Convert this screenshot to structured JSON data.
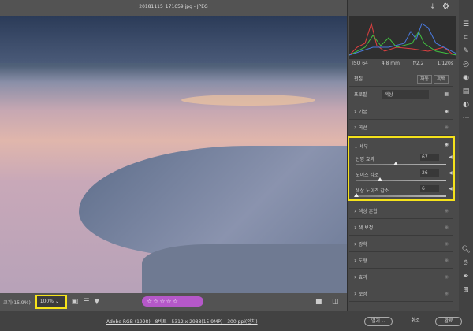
{
  "window": {
    "title": "20181115_171659.jpg - JPEG"
  },
  "histogram": {
    "iso": "ISO 64",
    "focal": "4.8 mm",
    "aperture": "f/2.2",
    "shutter": "1/120s"
  },
  "edit": {
    "label": "편집",
    "auto": "자동",
    "bw": "흑백"
  },
  "profile": {
    "label": "프로필",
    "value": "색상"
  },
  "sections": [
    "기본",
    "곡선"
  ],
  "detail": {
    "title": "세부",
    "sliders": [
      {
        "label": "선명 효과",
        "value": "67",
        "fraction": 0.45
      },
      {
        "label": "노이즈 감소",
        "value": "26",
        "fraction": 0.26
      },
      {
        "label": "색상 노이즈 감소",
        "value": "6",
        "fraction": 0.06
      }
    ]
  },
  "sections_after": [
    "색상 혼합",
    "색 보정",
    "광학",
    "도형",
    "효과",
    "보정"
  ],
  "bottom": {
    "zoom_label": "크기(15.9%)",
    "zoom_value": "100%",
    "stars": "☆☆☆☆☆"
  },
  "status": {
    "info": "Adobe RGB (1998) - 8비트 - 5312 x 2988(15.9MP) - 300 ppi(인치)",
    "open": "열기",
    "cancel": "취소",
    "done": "완료"
  }
}
